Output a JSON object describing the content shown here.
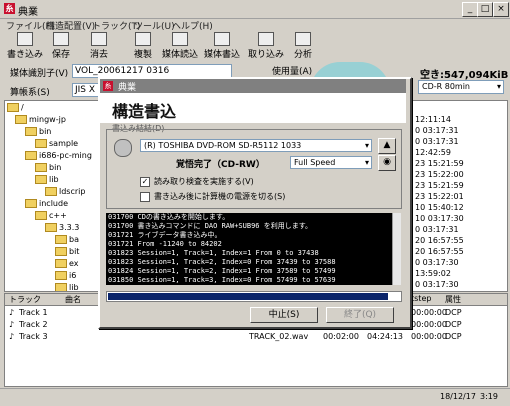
{
  "window": {
    "title": "典業",
    "logo_glyph": "糸"
  },
  "menu": [
    "ファイル(F)",
    "構造配置(V)",
    "トラック(T)",
    "ツール(U)",
    "ヘルプ(H)"
  ],
  "toolbar": [
    "書き込み",
    "保存",
    "消去",
    "複製",
    "媒体読込",
    "媒体書込",
    "取り込み",
    "分析"
  ],
  "media": {
    "volume_label": "媒体識別子(V)",
    "volume_value": "VOL_20061217 0316",
    "charset_label": "算帳系(S)",
    "charset_value": "JIS X",
    "usage_label": "使用量(A)",
    "free_space": "空き:547,094KiB",
    "media_type": "CD-R 80min"
  },
  "tree": [
    "/",
    "mingw-jp",
    "bin",
    "sample",
    "i686-pc-ming",
    "bin",
    "lib",
    "ldscrip",
    "include",
    "c++",
    "3.3.3",
    "ba",
    "bit",
    "ex",
    "i6",
    "lib"
  ],
  "right_list": [
    "12:11:14",
    "0 03:17:31",
    "0 03:17:31",
    "12:42:59",
    "23 15:21:59",
    "23 15:22:00",
    "23 15:21:59",
    "23 15:22:01",
    "10 15:40:12",
    "10 03:17:30",
    "0 03:17:31",
    "20 16:57:55",
    "20 16:57:55",
    "0 03:17:30",
    "13:59:02",
    "0 03:17:30",
    "0 03:17:31"
  ],
  "dialog": {
    "title": "典業",
    "heading": "構造書込",
    "group_label": "書込み結結(D)",
    "drive": "(R) TOSHIBA DVD-ROM SD-R5112 1033",
    "status": "覚悟完了（CD-RW）",
    "speed": "Full Speed",
    "verify_label": "読み取り検査を実施する(V)",
    "poweroff_label": "書き込み後に計算機の電源を切る(S)",
    "log": [
      "031700 CDの書き込みを開始します。",
      "031700 書き込みコマンドに DAO RAW+SUB96 を利用します。",
      "031721 ライブデータ書き込み中。",
      "031721 From -11240 to 84202",
      "031823 Session=1, Track=1, Index=1 From 0 to 37438",
      "031823 Session=1, Track=2, Index=0 From 37439 to 37588",
      "031824 Session=1, Track=2, Index=1 From 37589 to 57499",
      "031850 Session=1, Track=3, Index=0 From 57499 to 57639",
      "031851 Session=1, Track=3, Index=1 From 57640 to 77452"
    ],
    "progress": 0.96,
    "stop_button": "中止(S)",
    "end_button": "終了(Q)"
  },
  "tracks": {
    "headers": [
      "トラック",
      "曲名",
      "tstep",
      "属性"
    ],
    "rows": [
      {
        "name": "Track 1",
        "file": "",
        "t1": "",
        "t2": "",
        "attr": "DCP"
      },
      {
        "name": "Track 2",
        "file": "",
        "t1": "",
        "t2": "",
        "attr": "DCP"
      },
      {
        "name": "Track 3",
        "file": "TRACK_02.wav",
        "t1": "00:02:00",
        "t2": "04:24:13",
        "attr": "DCP"
      }
    ],
    "extra_times": [
      "00:00:00",
      "00:00:00",
      "00:00:00"
    ]
  },
  "statusbar": {
    "date": "18/12/17",
    "time": "3:19"
  }
}
